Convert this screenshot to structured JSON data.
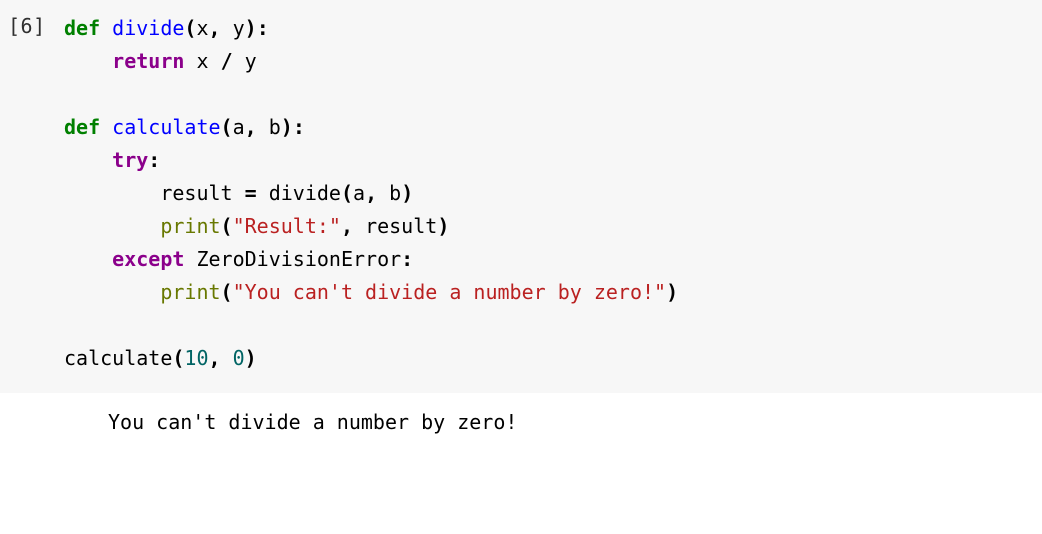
{
  "cell": {
    "prompt": "[6]",
    "code": {
      "l1": {
        "def": "def",
        "name": "divide",
        "params_open": "(",
        "p1": "x",
        "c1": ",",
        "sp1": " ",
        "p2": "y",
        "params_close": ")",
        "colon": ":"
      },
      "l2": {
        "indent": "    ",
        "ret": "return",
        "sp": " ",
        "a": "x",
        "sp2": " ",
        "op": "/",
        "sp3": " ",
        "b": "y"
      },
      "l3_blank": "",
      "l4": {
        "def": "def",
        "name": "calculate",
        "params_open": "(",
        "p1": "a",
        "c1": ",",
        "sp1": " ",
        "p2": "b",
        "params_close": ")",
        "colon": ":"
      },
      "l5": {
        "indent": "    ",
        "try": "try",
        "colon": ":"
      },
      "l6": {
        "indent": "        ",
        "lhs": "result",
        "sp": " ",
        "eq": "=",
        "sp2": " ",
        "call": "divide",
        "open": "(",
        "a": "a",
        "c": ",",
        "sp3": " ",
        "b": "b",
        "close": ")"
      },
      "l7": {
        "indent": "        ",
        "print": "print",
        "open": "(",
        "s": "\"Result:\"",
        "c": ",",
        "sp": " ",
        "v": "result",
        "close": ")"
      },
      "l8": {
        "indent": "    ",
        "except": "except",
        "sp": " ",
        "exc": "ZeroDivisionError",
        "colon": ":"
      },
      "l9": {
        "indent": "        ",
        "print": "print",
        "open": "(",
        "s": "\"You can't divide a number by zero!\"",
        "close": ")"
      },
      "l10_blank": "",
      "l11": {
        "call": "calculate",
        "open": "(",
        "n1": "10",
        "c": ",",
        "sp": " ",
        "n2": "0",
        "close": ")"
      }
    },
    "output": "You can't divide a number by zero!"
  }
}
